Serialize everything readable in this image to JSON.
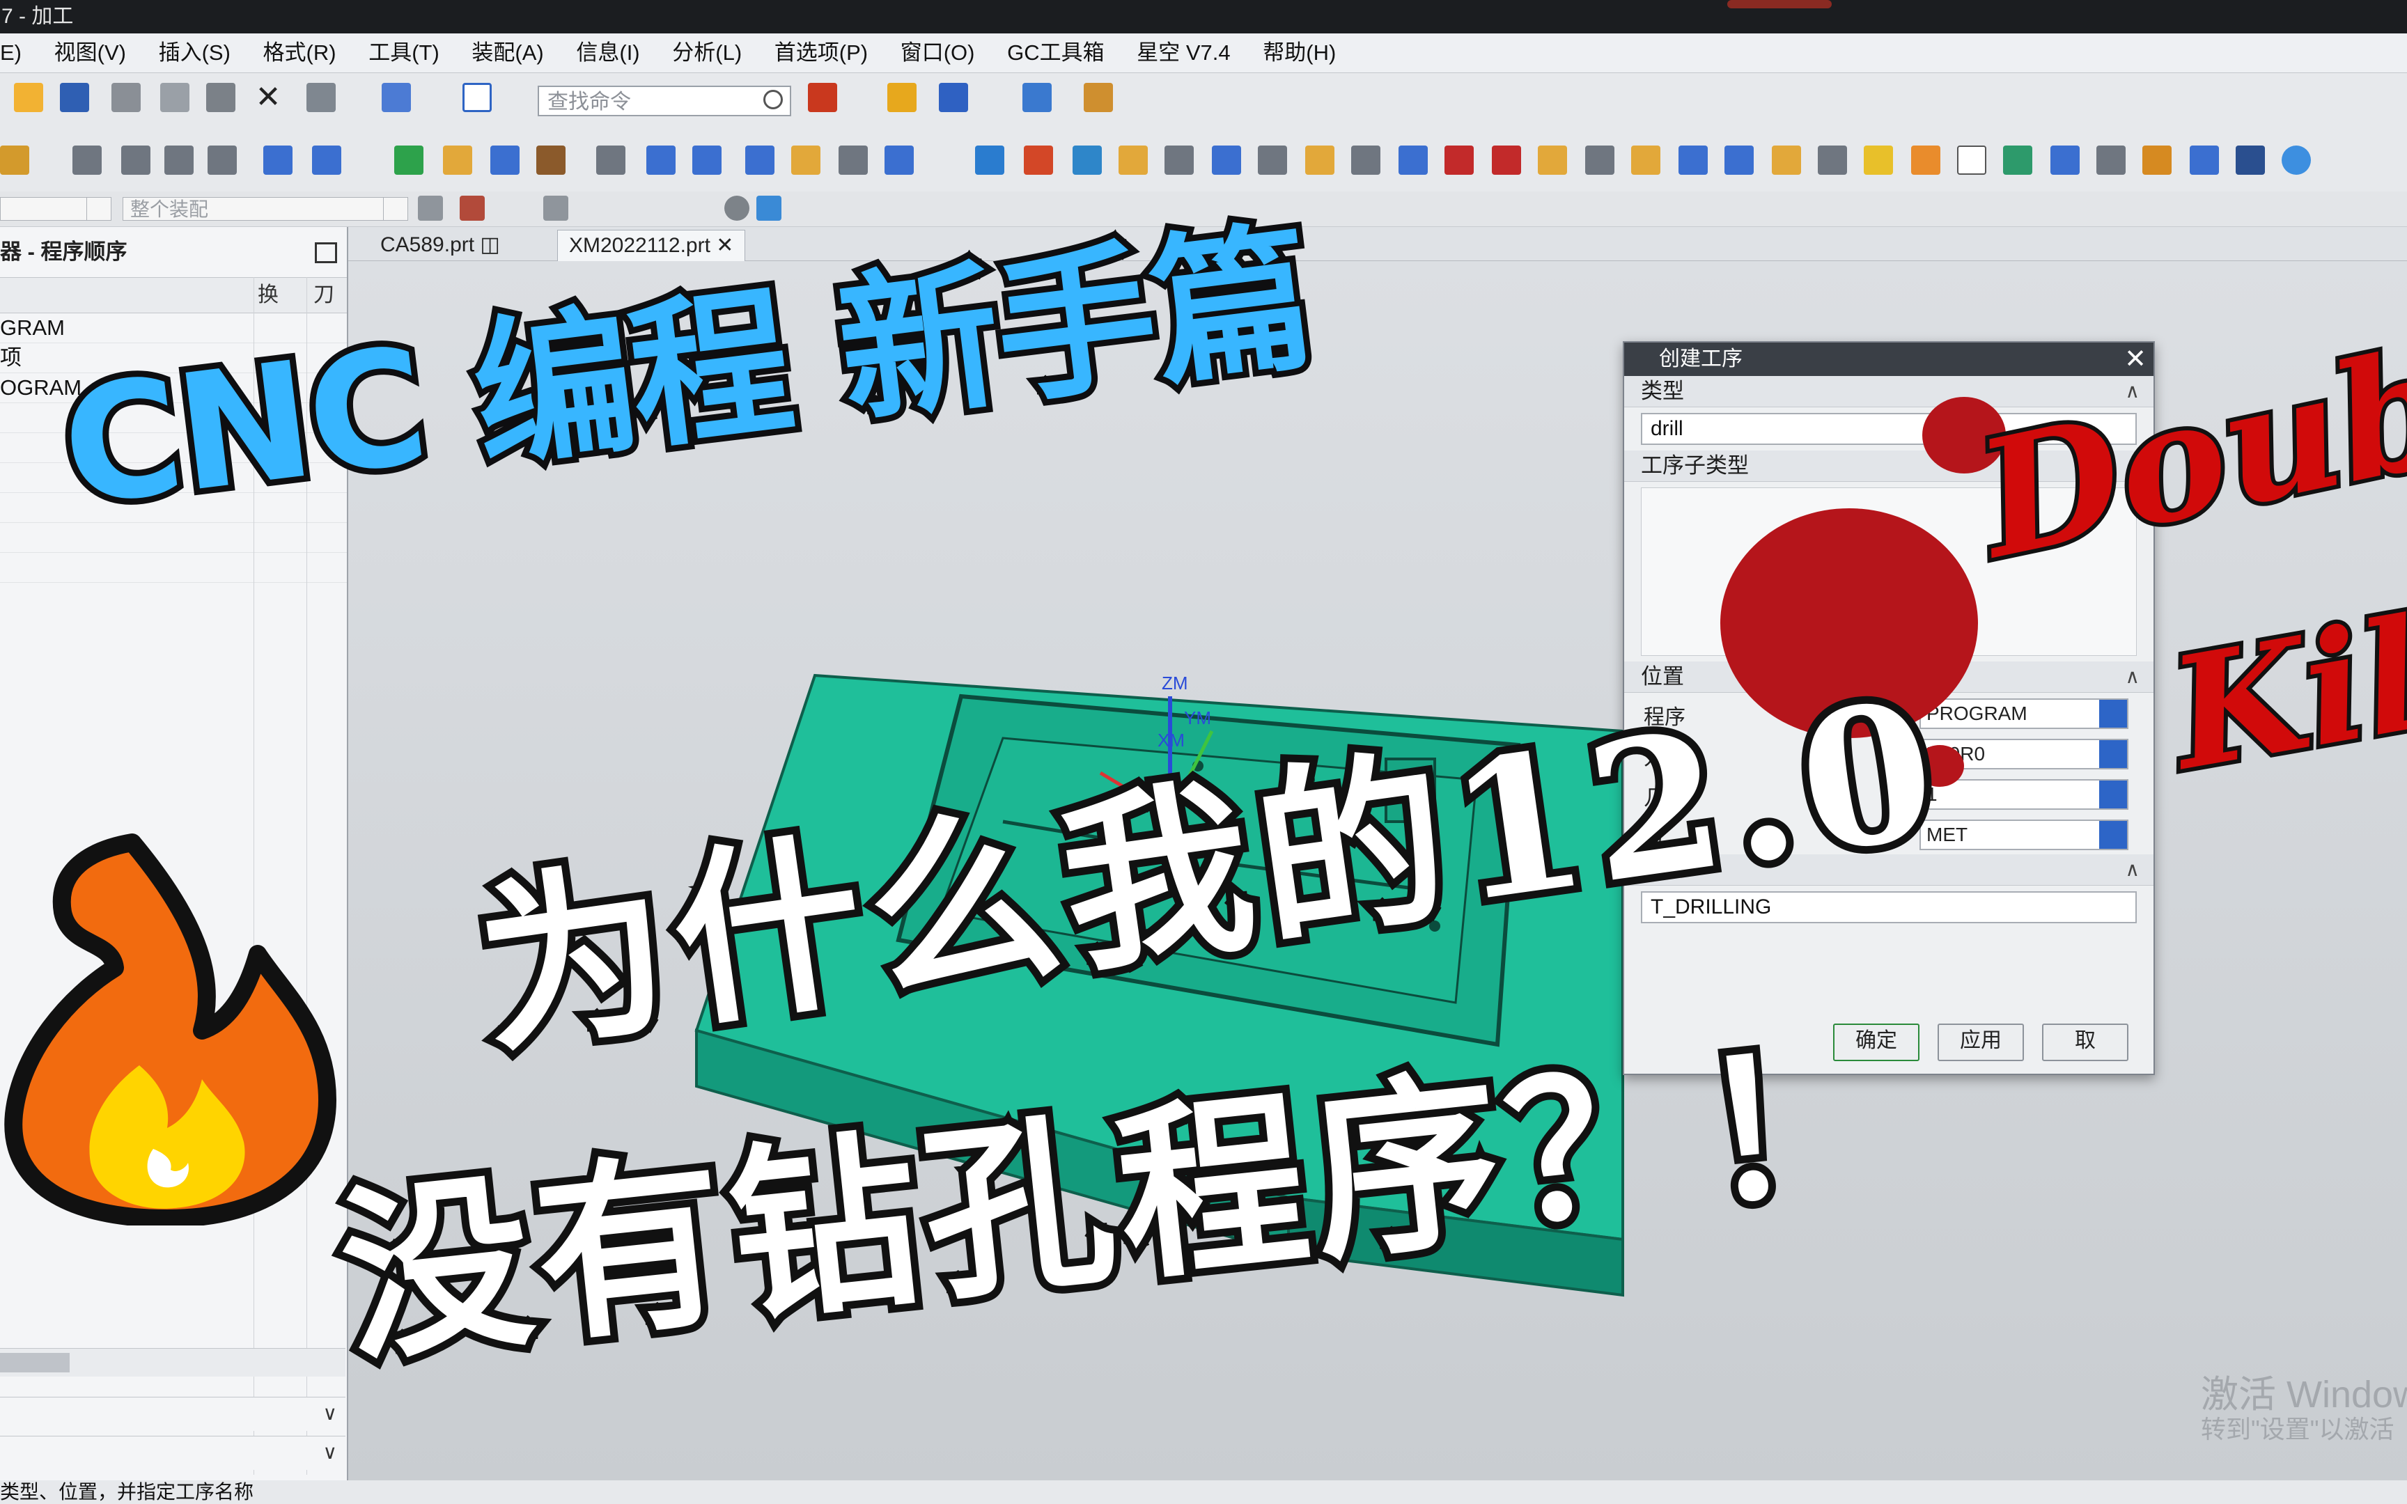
{
  "window": {
    "title": "7 - 加工"
  },
  "menu": [
    "E)",
    "视图(V)",
    "插入(S)",
    "格式(R)",
    "工具(T)",
    "装配(A)",
    "信息(I)",
    "分析(L)",
    "首选项(P)",
    "窗口(O)",
    "GC工具箱",
    "星空 V7.4",
    "帮助(H)"
  ],
  "toolbar": {
    "search_placeholder": "查找命令",
    "assembly_combo": "整个装配"
  },
  "navigator": {
    "title": "器 - 程序顺序",
    "col_swap": "换",
    "col_tool": "刀",
    "rows": [
      "GRAM",
      "项",
      "OGRAM"
    ]
  },
  "tabs": [
    {
      "label": "CA589.prt"
    },
    {
      "label": "XM2022112.prt"
    }
  ],
  "dialog": {
    "title": "创建工序",
    "type_section": "类型",
    "type_value": "drill",
    "subtype_section": "工序子类型",
    "position_section": "位置",
    "program_label": "程序",
    "program_value": "PROGRAM",
    "tool_label": "刀具",
    "tool_value": "F20R0",
    "geometry_label": "几",
    "geometry_value": "1",
    "method_label": "方",
    "method_value": "MET",
    "name_section": "名",
    "name_value": "T_DRILLING",
    "ok": "确定",
    "apply": "应用",
    "cancel": "取"
  },
  "overlay": {
    "title": "CNC 编程 新手篇",
    "line1": "为什么我的12.0",
    "line2": "没有钻孔程序？！",
    "badge1": "Doub",
    "badge2": "Kil"
  },
  "axis_labels": {
    "zm": "ZM",
    "ym": "YM",
    "xm": "XM"
  },
  "watermark": {
    "line1": "激活 Window",
    "line2": "转到\"设置\"以激活"
  },
  "status": {
    "text": "类型、位置，并指定工序名称"
  },
  "colors": {
    "accent_blue": "#38b6ff",
    "model_green": "#1fbf9a",
    "badge_red": "#d10a0a",
    "flame_orange": "#f26b0f",
    "flame_yellow": "#ffd400"
  }
}
